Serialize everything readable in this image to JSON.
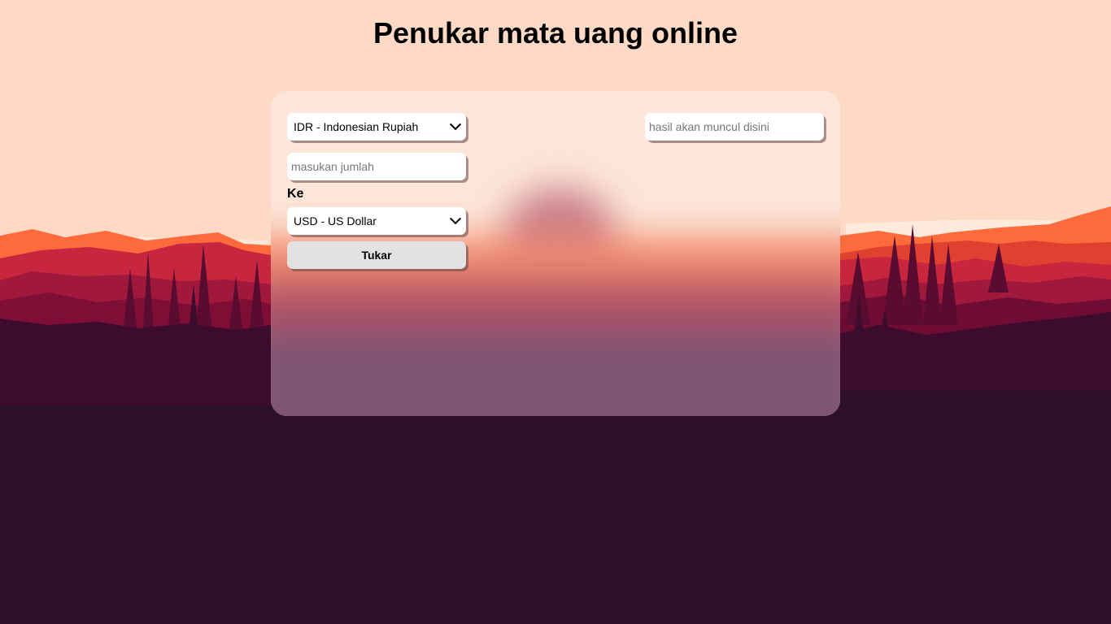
{
  "page": {
    "title": "Penukar mata uang online"
  },
  "converter": {
    "from_currency": "IDR - Indonesian Rupiah",
    "amount_placeholder": "masukan jumlah",
    "to_label": "Ke",
    "to_currency": "USD - US Dollar",
    "convert_button": "Tukar",
    "result_placeholder": "hasil akan muncul disini"
  },
  "colors": {
    "sky": "#fed9c6",
    "mountain_orange": "#fd6b3d",
    "mountain_red": "#c8263f",
    "mountain_dark": "#7f0e36",
    "forest": "#2d1029"
  }
}
